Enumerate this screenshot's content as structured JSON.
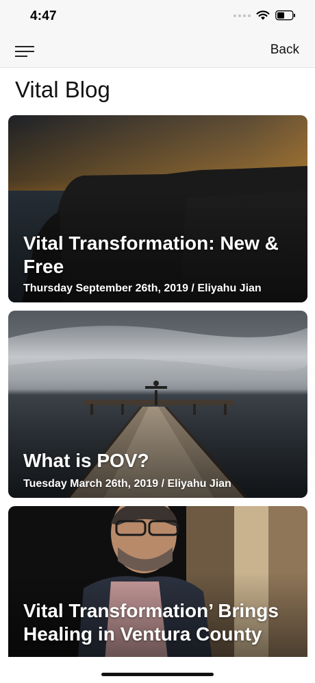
{
  "status_bar": {
    "time": "4:47"
  },
  "nav": {
    "back_label": "Back"
  },
  "page": {
    "title": "Vital Blog"
  },
  "posts": [
    {
      "title": "Vital Transformation: New & Free",
      "meta": "Thursday September 26th, 2019 / Eliyahu Jian"
    },
    {
      "title": "What is POV?",
      "meta": "Tuesday March 26th, 2019 / Eliyahu Jian"
    },
    {
      "title": "Vital Transformation’ Brings Healing in Ventura County",
      "meta": ""
    }
  ]
}
